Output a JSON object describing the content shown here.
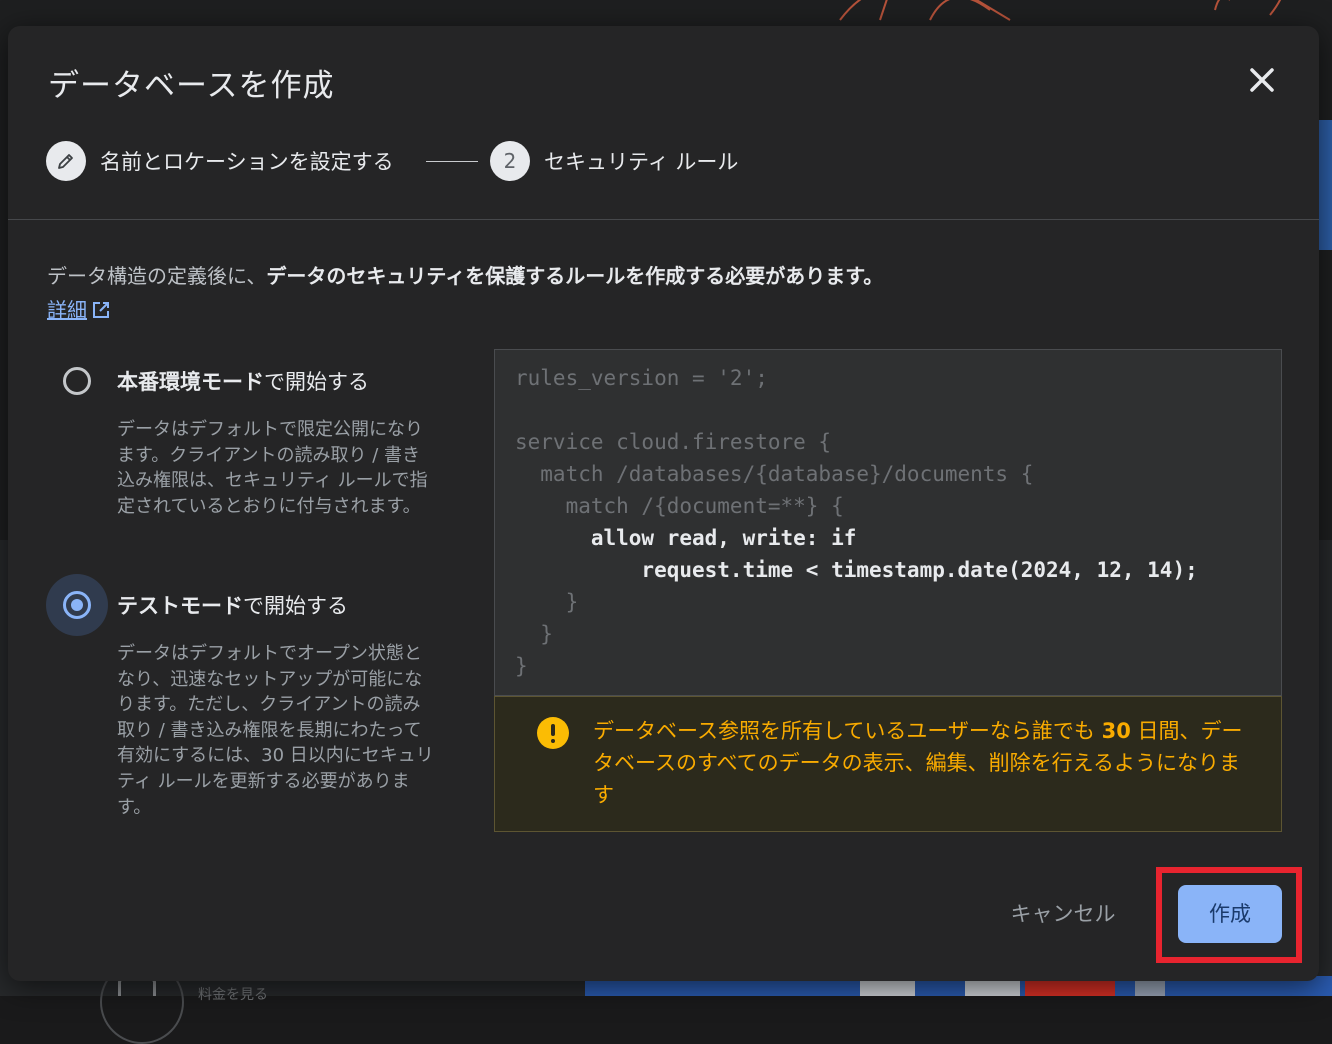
{
  "background": {
    "price_link": "料金を見る"
  },
  "dialog": {
    "title": "データベースを作成",
    "close_icon": "close-icon",
    "stepper": {
      "step1_label": "名前とロケーションを設定する",
      "step1_icon": "pencil-icon",
      "step2_number": "2",
      "step2_label": "セキュリティ ルール"
    },
    "intro_plain": "データ構造の定義後に、",
    "intro_bold": "データのセキュリティを保護するルールを作成する必要があります。",
    "details_link": "詳細",
    "options": [
      {
        "title_bold": "本番環境モード",
        "title_rest": "で開始する",
        "description": "データはデフォルトで限定公開になります。クライアントの読み取り / 書き込み権限は、セキュリティ ルールで指定されているとおりに付与されます。",
        "checked": false
      },
      {
        "title_bold": "テストモード",
        "title_rest": "で開始する",
        "description": "データはデフォルトでオープン状態となり、迅速なセットアップが可能になります。ただし、クライアントの読み取り / 書き込み権限を長期にわたって有効にするには、30 日以内にセキュリティ ルールを更新する必要があります。",
        "checked": true
      }
    ],
    "code_lines": [
      "rules_version = '2';",
      "",
      "service cloud.firestore {",
      "  match /databases/{database}/documents {",
      "    match /{document=**} {",
      "      allow read, write: if",
      "          request.time < timestamp.date(2024, 12, 14);",
      "    }",
      "  }",
      "}"
    ],
    "warning": {
      "icon": "warning-icon",
      "text_before": "データベース参照を所有しているユーザーなら誰でも ",
      "text_bold": "30",
      "text_after": " 日間、データベースのすべてのデータの表示、編集、削除を行えるようになります"
    },
    "footer": {
      "cancel_label": "キャンセル",
      "create_label": "作成"
    }
  },
  "colors": {
    "accent": "#8ab4f8",
    "warning": "#f9ab00",
    "highlight": "#e8242f"
  }
}
